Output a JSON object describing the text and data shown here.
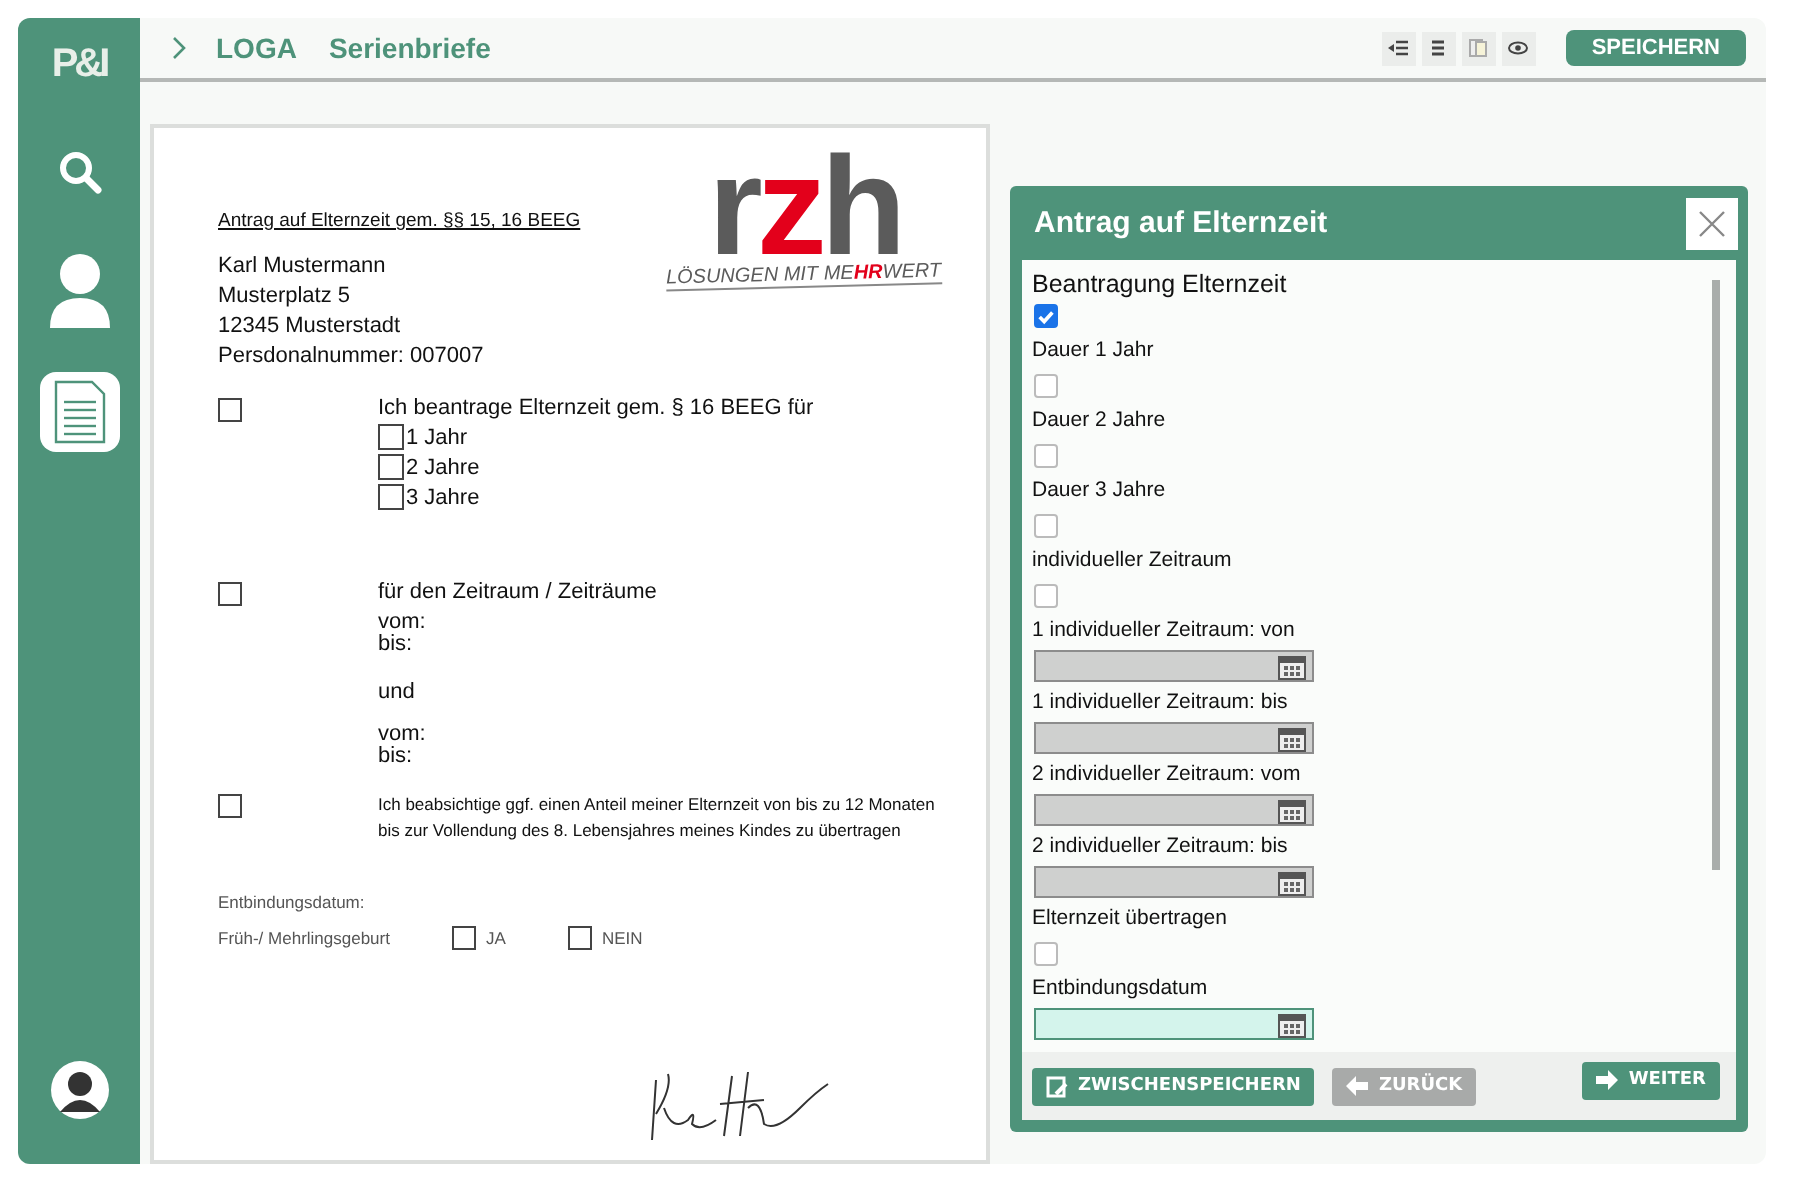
{
  "sidebar": {
    "logo": "P&I",
    "items": [
      {
        "kind": "search",
        "selected": false
      },
      {
        "kind": "person",
        "selected": false
      },
      {
        "kind": "document",
        "selected": true
      }
    ]
  },
  "header": {
    "breadcrumb": [
      "LOGA",
      "Serienbriefe"
    ],
    "tools": [
      {
        "kind": "indent"
      },
      {
        "kind": "list"
      },
      {
        "kind": "copy"
      },
      {
        "kind": "eye"
      }
    ],
    "save_button": "SPEICHERN"
  },
  "document": {
    "heading": "Antrag auf Elternzeit gem. §§ 15, 16 BEEG",
    "address": [
      "Karl Mustermann",
      "Musterplatz 5",
      "12345 Musterstadt",
      "Persdonalnummer: 007007"
    ],
    "logo": {
      "letters": [
        {
          "text": "r",
          "color": "#5b5b5b"
        },
        {
          "text": "z",
          "color": "#e3001b"
        },
        {
          "text": "h",
          "color": "#5b5b5b"
        }
      ],
      "tagline": [
        {
          "text": "LÖSUNGEN MIT ME",
          "color": "#5b5b5b"
        },
        {
          "text": "HR",
          "color": "#e3001b"
        },
        {
          "text": "WERT",
          "color": "#5b5b5b"
        }
      ]
    },
    "sections": [
      {
        "kind": "duration",
        "checked": false,
        "text": "Ich beantrage Elternzeit gem. § 16 BEEG für",
        "options": [
          {
            "label": "1 Jahr",
            "checked": false
          },
          {
            "label": "2 Jahre",
            "checked": false
          },
          {
            "label": "3 Jahre",
            "checked": false
          }
        ]
      },
      {
        "kind": "period",
        "checked": false,
        "text": "für den Zeitraum / Zeiträume",
        "periods": [
          [
            "vom:",
            "bis:"
          ],
          [
            "vom:",
            "bis:"
          ]
        ],
        "joiner": "und"
      },
      {
        "kind": "transfer",
        "checked": false,
        "lines": [
          "Ich beabsichtige ggf. einen Anteil meiner Elternzeit von bis zu 12 Monaten",
          "bis zur Vollendung des 8. Lebensjahres meines Kindes zu übertragen"
        ]
      }
    ],
    "birth_date_label": "Entbindungsdatum:",
    "multiple_birth": {
      "label": "Früh-/ Mehrlingsgeburt",
      "options": [
        {
          "label": "JA",
          "checked": false
        },
        {
          "label": "NEIN",
          "checked": false
        }
      ]
    }
  },
  "dialog": {
    "title": "Antrag auf Elternzeit",
    "form_title": "Beantragung Elternzeit",
    "fields": [
      {
        "kind": "checkbox",
        "checked": true
      },
      {
        "kind": "checkbox",
        "label": "Dauer 1 Jahr",
        "checked": false
      },
      {
        "kind": "checkbox",
        "label": "Dauer 2 Jahre",
        "checked": false
      },
      {
        "kind": "checkbox",
        "label": "Dauer 3 Jahre",
        "checked": false
      },
      {
        "kind": "checkbox",
        "label": "individueller Zeitraum",
        "checked": false
      },
      {
        "kind": "date",
        "label": "1 individueller Zeitraum: von",
        "focused": false
      },
      {
        "kind": "date",
        "label": "1 individueller Zeitraum: bis",
        "focused": false
      },
      {
        "kind": "date",
        "label": "2 individueller Zeitraum: vom",
        "focused": false
      },
      {
        "kind": "date",
        "label": "2 individueller Zeitraum: bis",
        "focused": false
      },
      {
        "kind": "checkbox",
        "label": "Elternzeit übertragen",
        "checked": false
      },
      {
        "kind": "date",
        "label": "Entbindungsdatum",
        "focused": true
      }
    ],
    "buttons": [
      {
        "kind": "save",
        "label": "ZWISCHENSPEICHERN",
        "disabled": false
      },
      {
        "kind": "back",
        "label": "ZURÜCK",
        "disabled": true
      },
      {
        "kind": "next",
        "label": "WEITER",
        "disabled": false
      }
    ]
  }
}
